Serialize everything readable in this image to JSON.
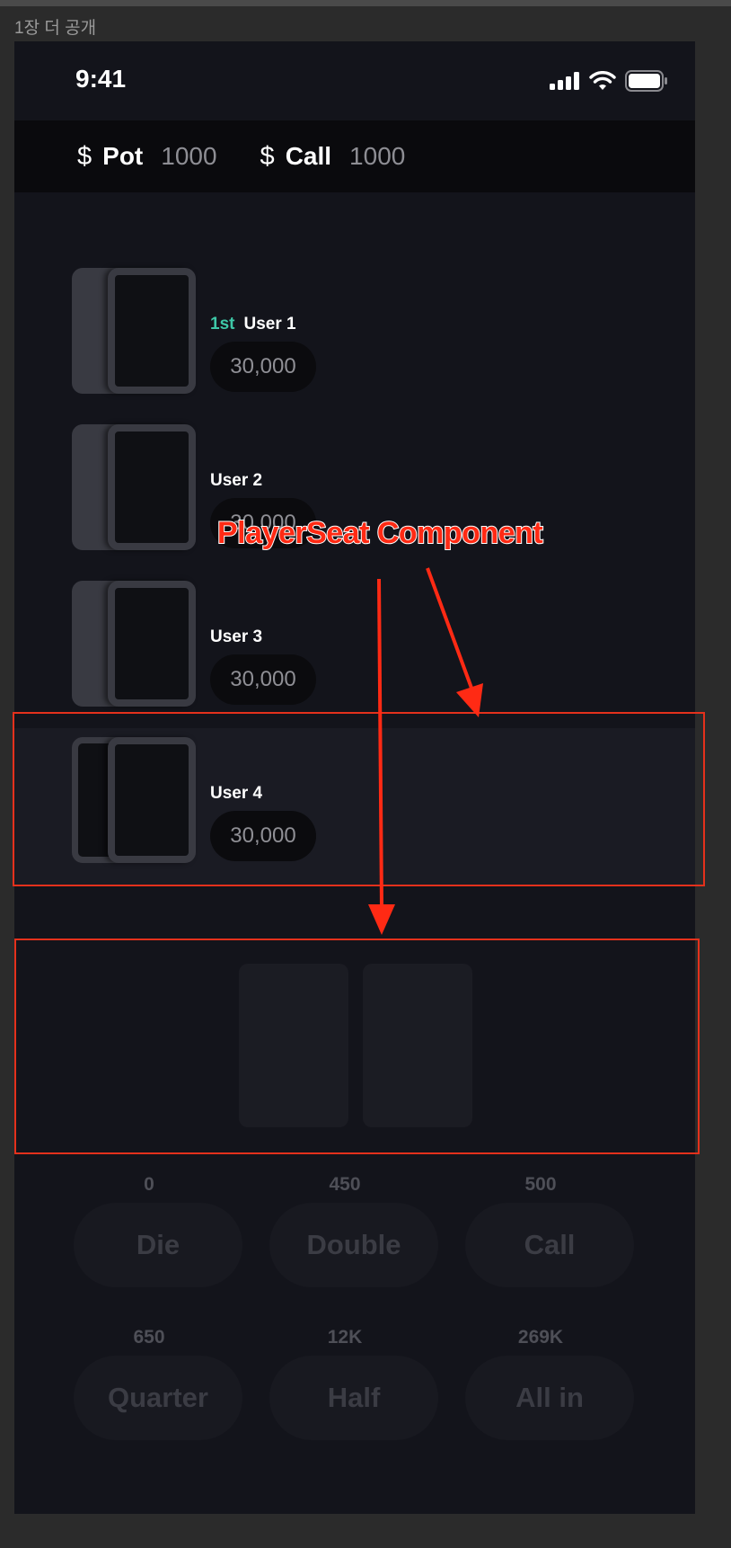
{
  "frame_label": "1장 더 공개",
  "status_bar": {
    "time": "9:41"
  },
  "pot_bar": {
    "pot": {
      "icon": "$",
      "label": "Pot",
      "value": "1000"
    },
    "call": {
      "icon": "$",
      "label": "Call",
      "value": "1000"
    }
  },
  "seats": [
    {
      "rank": "1st",
      "name": "User 1",
      "chips": "30,000"
    },
    {
      "rank": "",
      "name": "User 2",
      "chips": "30,000"
    },
    {
      "rank": "",
      "name": "User 3",
      "chips": "30,000"
    },
    {
      "rank": "",
      "name": "User 4",
      "chips": "30,000"
    }
  ],
  "bet_buttons": [
    {
      "amount": "0",
      "label": "Die"
    },
    {
      "amount": "450",
      "label": "Double"
    },
    {
      "amount": "500",
      "label": "Call"
    },
    {
      "amount": "650",
      "label": "Quarter"
    },
    {
      "amount": "12K",
      "label": "Half"
    },
    {
      "amount": "269K",
      "label": "All in"
    }
  ],
  "annotation": {
    "title": "PlayerSeat Component",
    "color": "#e4311c"
  },
  "colors": {
    "background": "#13141b",
    "accent_rank": "#3ec7a7",
    "active_seat": "#1a1b23"
  }
}
